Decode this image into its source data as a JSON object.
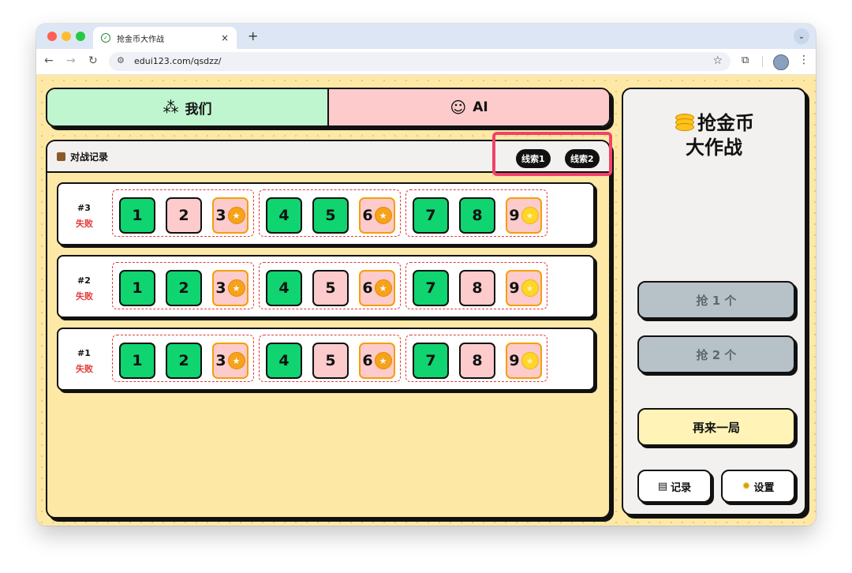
{
  "browser": {
    "tab_title": "抢金币大作战",
    "tab_close": "×",
    "new_tab": "+",
    "url": "edui123.com/qsdzz/"
  },
  "teams": {
    "us_label": "我们",
    "ai_label": "AI"
  },
  "record": {
    "title": "对战记录",
    "hint1": "线索1",
    "hint2": "线索2"
  },
  "rounds": [
    {
      "num": "#3",
      "result": "失败",
      "cells": [
        {
          "n": "1",
          "color": "green"
        },
        {
          "n": "2",
          "color": "pink"
        },
        {
          "n": "3",
          "color": "pink",
          "coin": "orange"
        },
        {
          "n": "4",
          "color": "green"
        },
        {
          "n": "5",
          "color": "green"
        },
        {
          "n": "6",
          "color": "pink",
          "coin": "orange"
        },
        {
          "n": "7",
          "color": "green"
        },
        {
          "n": "8",
          "color": "green"
        },
        {
          "n": "9",
          "color": "pink",
          "coin": "gold"
        }
      ]
    },
    {
      "num": "#2",
      "result": "失败",
      "cells": [
        {
          "n": "1",
          "color": "green"
        },
        {
          "n": "2",
          "color": "green"
        },
        {
          "n": "3",
          "color": "pink",
          "coin": "orange"
        },
        {
          "n": "4",
          "color": "green"
        },
        {
          "n": "5",
          "color": "pink"
        },
        {
          "n": "6",
          "color": "pink",
          "coin": "orange"
        },
        {
          "n": "7",
          "color": "green"
        },
        {
          "n": "8",
          "color": "pink"
        },
        {
          "n": "9",
          "color": "pink",
          "coin": "gold"
        }
      ]
    },
    {
      "num": "#1",
      "result": "失败",
      "cells": [
        {
          "n": "1",
          "color": "green"
        },
        {
          "n": "2",
          "color": "green"
        },
        {
          "n": "3",
          "color": "pink",
          "coin": "orange"
        },
        {
          "n": "4",
          "color": "green"
        },
        {
          "n": "5",
          "color": "pink"
        },
        {
          "n": "6",
          "color": "pink",
          "coin": "orange"
        },
        {
          "n": "7",
          "color": "green"
        },
        {
          "n": "8",
          "color": "pink"
        },
        {
          "n": "9",
          "color": "pink",
          "coin": "gold"
        }
      ]
    }
  ],
  "side": {
    "title_line1": "抢金币",
    "title_line2": "大作战",
    "grab1": "抢 1 个",
    "grab2": "抢 2 个",
    "restart": "再来一局",
    "records_btn": "记录",
    "settings_btn": "设置"
  },
  "colors": {
    "green_cell": "#0fd46f",
    "pink_cell": "#fdcbcb",
    "coin_orange": "#f7a21b",
    "coin_gold": "#ffd52a",
    "fail_red": "#e23a3a",
    "highlight": "#f0426a"
  }
}
